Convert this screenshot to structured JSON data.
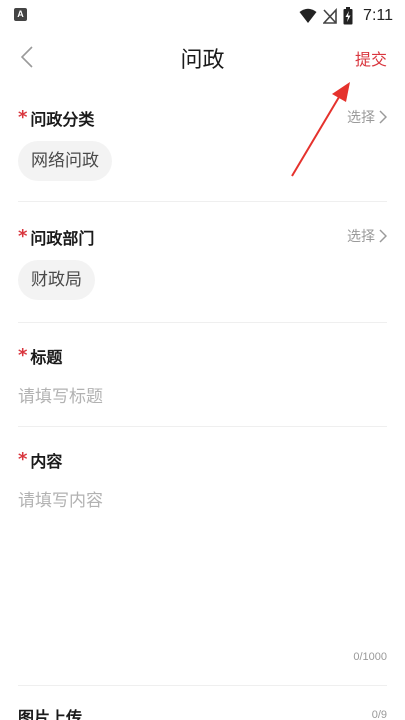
{
  "status_bar": {
    "app_badge": "A",
    "time": "7:11"
  },
  "nav": {
    "title": "问政",
    "submit_label": "提交"
  },
  "form": {
    "required_mark": "*",
    "select_label": "选择",
    "category": {
      "label": "问政分类",
      "value": "网络问政"
    },
    "department": {
      "label": "问政部门",
      "value": "财政局"
    },
    "title_field": {
      "label": "标题",
      "placeholder": "请填写标题"
    },
    "content_field": {
      "label": "内容",
      "placeholder": "请填写内容",
      "counter": "0/1000"
    },
    "image_upload": {
      "label": "图片上传",
      "counter": "0/9"
    }
  },
  "colors": {
    "accent": "#d9363e",
    "placeholder": "#b2b2b2",
    "chip_bg": "#f3f3f3"
  }
}
